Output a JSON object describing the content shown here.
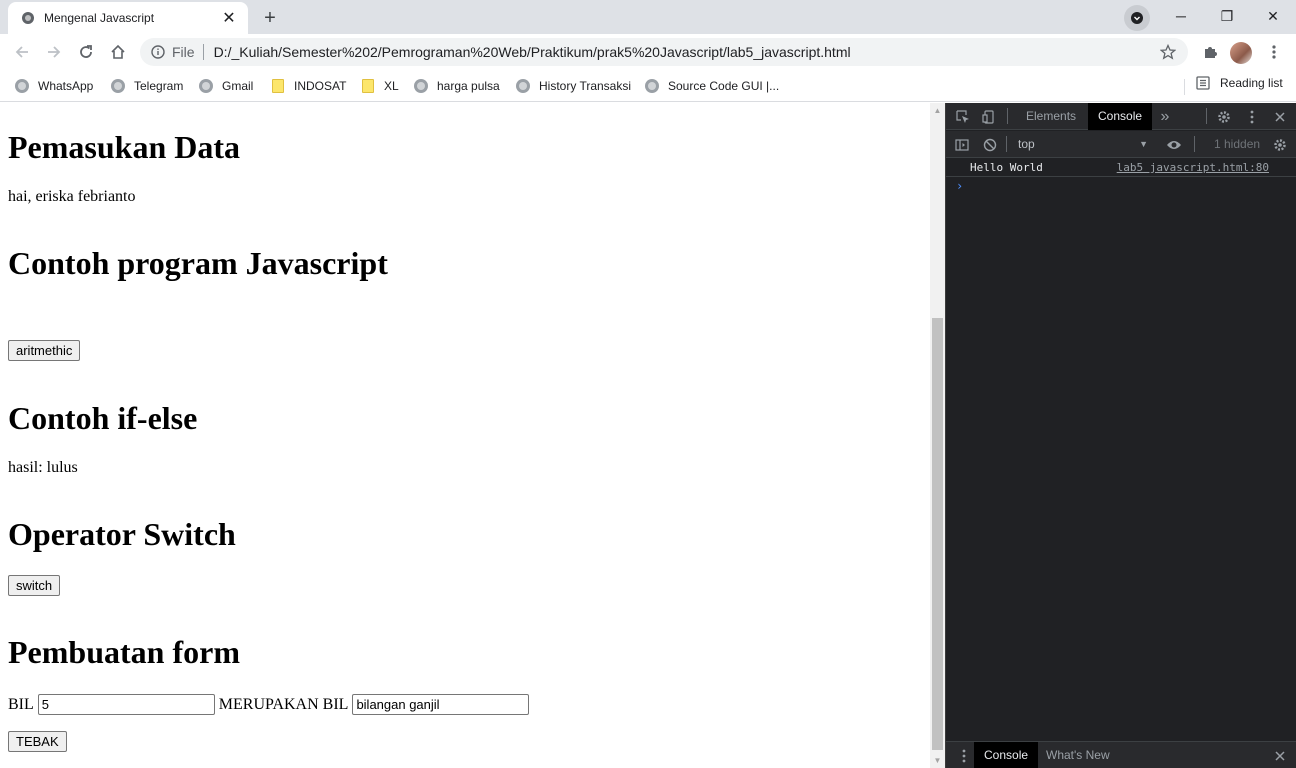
{
  "browser": {
    "tab": {
      "title": "Mengenal Javascript",
      "close": "✕"
    },
    "newtab": "+",
    "window": {
      "minimize": "─",
      "restore": "❐",
      "close": "✕"
    },
    "omnibox": {
      "file_label": "File",
      "url": "D:/_Kuliah/Semester%202/Pemrograman%20Web/Praktikum/prak5%20Javascript/lab5_javascript.html"
    },
    "bookmarks": [
      {
        "label": "WhatsApp",
        "icon": "globe"
      },
      {
        "label": "Telegram",
        "icon": "globe"
      },
      {
        "label": "Gmail",
        "icon": "globe"
      },
      {
        "label": "INDOSAT",
        "icon": "folder"
      },
      {
        "label": "XL",
        "icon": "folder"
      },
      {
        "label": "harga pulsa",
        "icon": "globe"
      },
      {
        "label": "History Transaksi",
        "icon": "globe"
      },
      {
        "label": "Source Code GUI |...",
        "icon": "globe"
      }
    ],
    "reading_list": "Reading list"
  },
  "page": {
    "h_input": "Pemasukan Data",
    "greeting": "hai, eriska febrianto",
    "h_program": "Contoh program Javascript",
    "btn_aritmethic": "aritmethic",
    "h_ifelse": "Contoh if-else",
    "result_ifelse": "hasil: lulus",
    "h_switch": "Operator Switch",
    "btn_switch": "switch",
    "h_form": "Pembuatan form",
    "form": {
      "label_bil": "BIL",
      "bil_value": "5",
      "label_merupakan": "MERUPAKAN BIL",
      "result_value": "bilangan ganjil",
      "btn_tebak": "TEBAK"
    }
  },
  "devtools": {
    "tabs": [
      "Elements",
      "Console"
    ],
    "active_tab": "Console",
    "more": "»",
    "context": "top",
    "hidden_count": "1 hidden",
    "console": {
      "message": "Hello World",
      "source": "lab5 javascript.html:80",
      "prompt": "›"
    },
    "drawer_tabs": [
      "Console",
      "What's New"
    ],
    "drawer_close": "✕"
  }
}
